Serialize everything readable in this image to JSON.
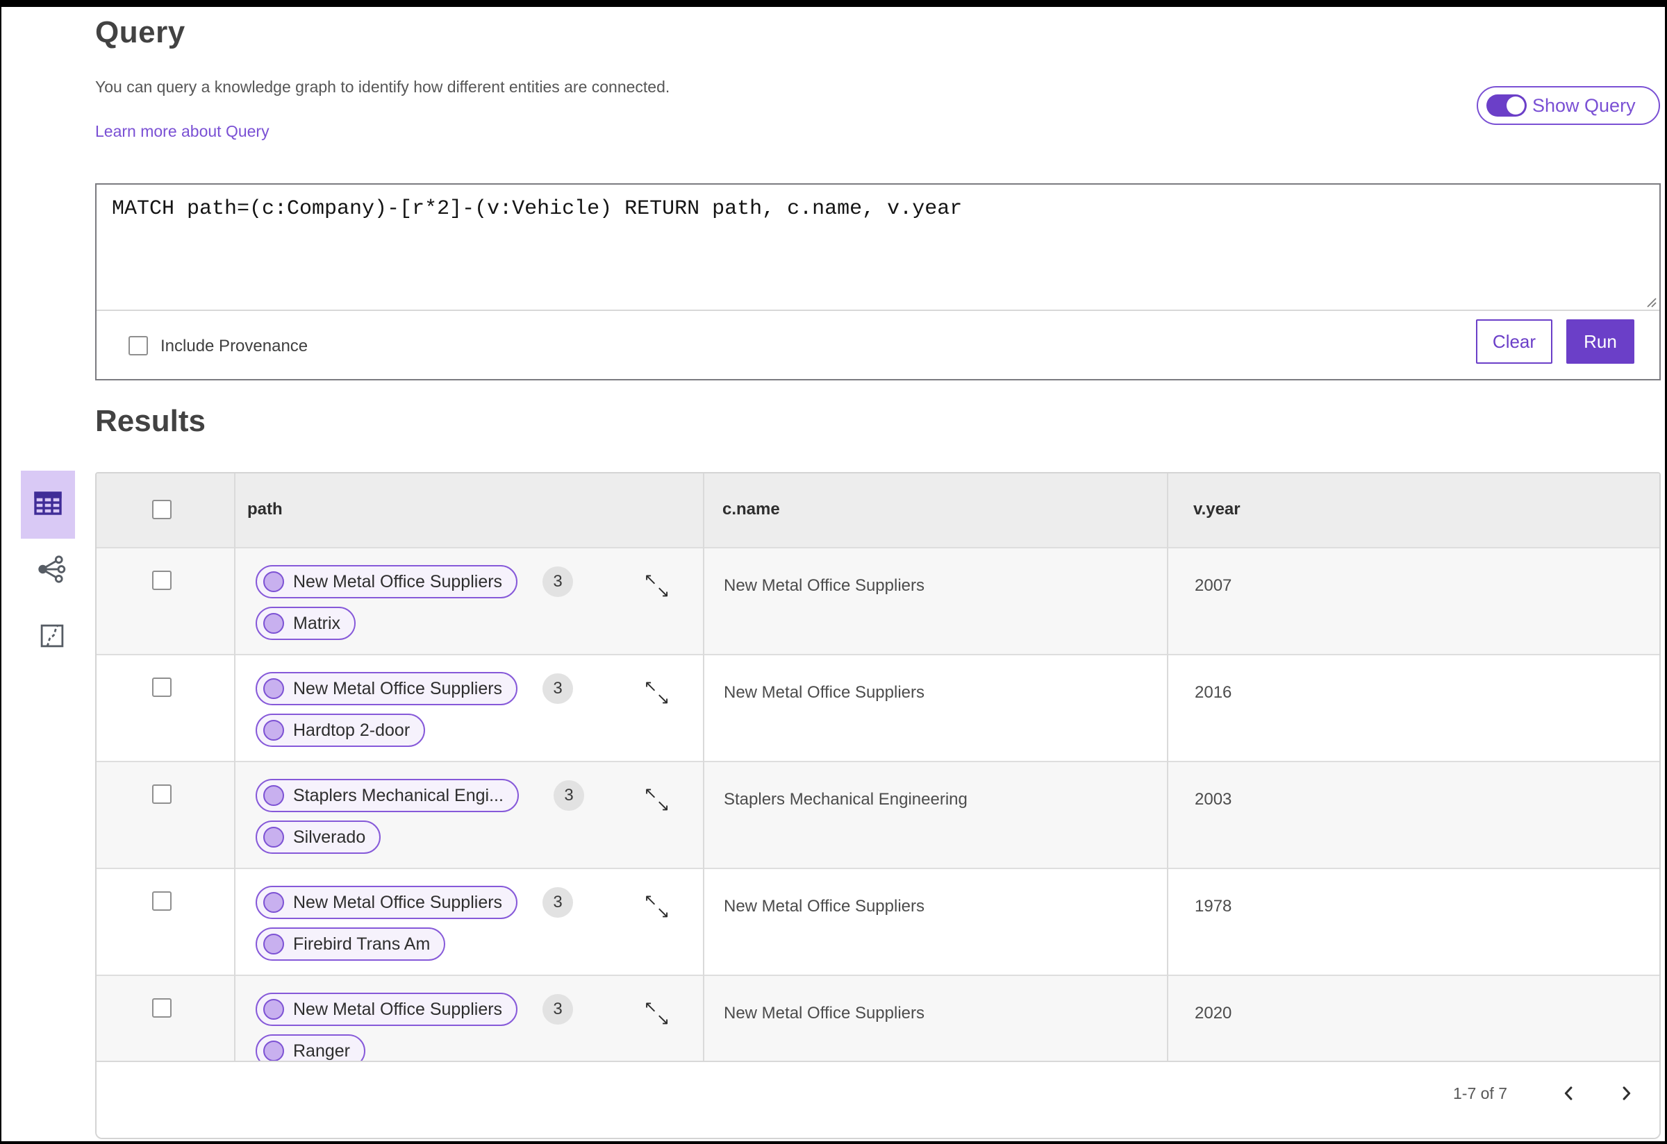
{
  "accents": {
    "purple": "#6b3fc8",
    "purple_light": "#d9c9f5",
    "pill_border": "#8659d9",
    "pill_bg": "#f6f2fc"
  },
  "header": {
    "title": "Query",
    "description": "You can query a knowledge graph to identify how different entities are connected.",
    "learn_more": "Learn more about Query",
    "show_query_label": "Show Query",
    "show_query_on": true
  },
  "query_panel": {
    "query_text": "MATCH path=(c:Company)-[r*2]-(v:Vehicle) RETURN path, c.name, v.year",
    "include_provenance_label": "Include Provenance",
    "include_provenance_checked": false,
    "clear_label": "Clear",
    "run_label": "Run"
  },
  "results": {
    "title": "Results",
    "view_icons": [
      "table-view-icon",
      "graph-view-icon",
      "map-view-icon"
    ],
    "columns": [
      "path",
      "c.name",
      "v.year"
    ],
    "rows": [
      {
        "path_nodes": [
          "New Metal Office Suppliers",
          "Matrix"
        ],
        "count": "3",
        "c_name": "New Metal Office Suppliers",
        "v_year": "2007"
      },
      {
        "path_nodes": [
          "New Metal Office Suppliers",
          "Hardtop 2-door"
        ],
        "count": "3",
        "c_name": "New Metal Office Suppliers",
        "v_year": "2016"
      },
      {
        "path_nodes": [
          "Staplers Mechanical Engi...",
          "Silverado"
        ],
        "count": "3",
        "c_name": "Staplers Mechanical Engineering",
        "v_year": "2003"
      },
      {
        "path_nodes": [
          "New Metal Office Suppliers",
          "Firebird Trans Am"
        ],
        "count": "3",
        "c_name": "New Metal Office Suppliers",
        "v_year": "1978"
      },
      {
        "path_nodes": [
          "New Metal Office Suppliers",
          "Ranger"
        ],
        "count": "3",
        "c_name": "New Metal Office Suppliers",
        "v_year": "2020"
      }
    ],
    "pagination": {
      "range_label": "1-7 of 7"
    }
  }
}
